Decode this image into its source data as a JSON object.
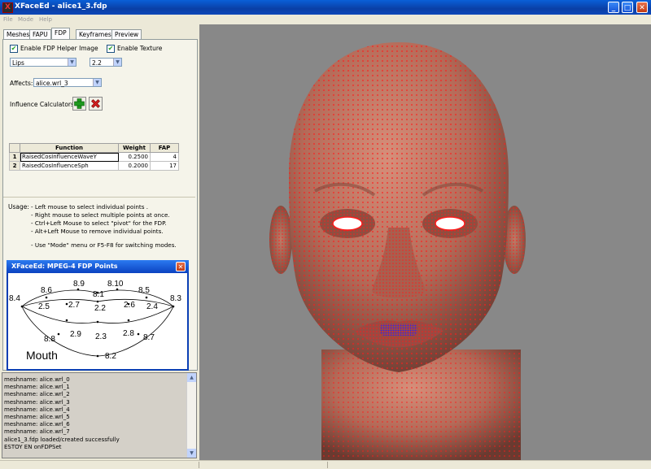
{
  "window": {
    "title": "XFaceEd - alice1_3.fdp",
    "app_icon": "X",
    "minimize": "_",
    "maximize": "□",
    "close": "✕"
  },
  "menu": [
    "File",
    "Mode",
    "Help"
  ],
  "tabs": [
    "Meshes",
    "FAPU",
    "FDP",
    "Keyframes",
    "Preview"
  ],
  "active_tab": "FDP",
  "fdp_panel": {
    "helper_image_label": "Enable FDP Helper Image",
    "helper_image_checked": true,
    "texture_label": "Enable Texture",
    "texture_checked": true,
    "region_value": "Lips",
    "point_value": "2.2",
    "affects_label": "Affects:",
    "affects_value": "alice.wrl_3",
    "influence_label": "Influence Calculators:",
    "table": {
      "headers": [
        "Function",
        "Weight",
        "FAP"
      ],
      "rows": [
        {
          "n": "1",
          "function": "RaisedCosInfluenceWaveY",
          "weight": "0.2500",
          "fap": "4"
        },
        {
          "n": "2",
          "function": "RaisedCosInfluenceSph",
          "weight": "0.2000",
          "fap": "17"
        }
      ]
    },
    "usage_label": "Usage:",
    "usage_lines": [
      "- Left mouse to select individual points .",
      "- Right mouse to select multiple points at once.",
      "- Ctrl+Left Mouse to select \"pivot\" for the FDP.",
      "- Alt+Left Mouse to remove individual points.",
      "- Use \"Mode\" menu or F5-F8 for switching modes."
    ]
  },
  "fdp_dialog": {
    "title": "XFaceEd: MPEG-4 FDP Points",
    "caption": "Mouth",
    "points": [
      "8.4",
      "8.6",
      "8.9",
      "8.1",
      "8.10",
      "8.5",
      "8.3",
      "2.5",
      "2.7",
      "2.2",
      "2.6",
      "2.4",
      "2.9",
      "2.3",
      "2.8",
      "8.8",
      "8.7",
      "8.2"
    ]
  },
  "console_lines": [
    "meshname: alice.wrl_0",
    "meshname: alice.wrl_1",
    "meshname: alice.wrl_2",
    "meshname: alice.wrl_3",
    "meshname: alice.wrl_4",
    "meshname: alice.wrl_5",
    "meshname: alice.wrl_6",
    "meshname: alice.wrl_7",
    "alice1_3.fdp loaded/created successfully",
    "ESTOY EN onFDPSet"
  ],
  "colors": {
    "skin": "#b9705e",
    "mesh_points": "#ff1a1a",
    "selected_points": "#3322ee",
    "viewport_bg": "#888888",
    "title_bar": "#0a4fc8"
  }
}
